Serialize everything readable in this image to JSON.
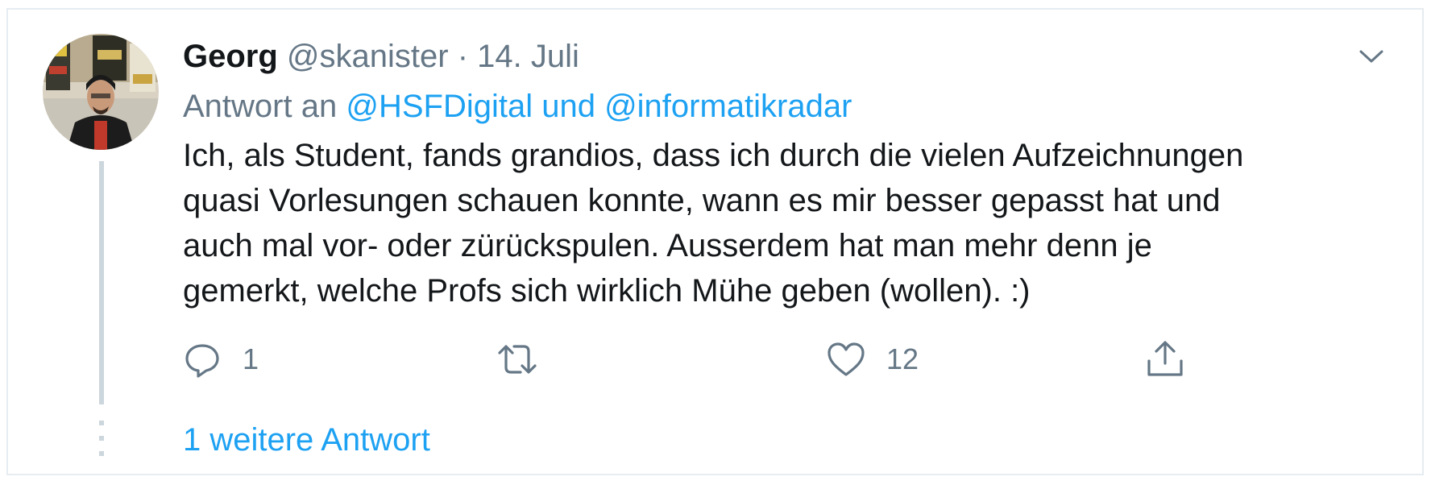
{
  "tweet": {
    "author_name": "Georg",
    "handle": "@skanister",
    "separator": "·",
    "date": "14. Juli",
    "reply_prefix": "Antwort an",
    "reply_mentions": "@HSFDigital und @informatikradar",
    "text_lines": [
      "Ich, als Student, fands grandios, dass ich durch die vielen Aufzeichnungen",
      "quasi Vorlesungen schauen konnte, wann es mir besser gepasst hat und",
      "auch mal vor- oder zürückspulen. Ausserdem hat man mehr denn je",
      "gemerkt, welche Profs sich wirklich Mühe geben (wollen). :)"
    ],
    "actions": {
      "reply": {
        "icon": "reply-icon",
        "count": "1"
      },
      "retweet": {
        "icon": "retweet-icon",
        "count": ""
      },
      "like": {
        "icon": "heart-icon",
        "count": "12"
      },
      "share": {
        "icon": "share-icon"
      }
    },
    "more_replies_label": "1 weitere Antwort"
  },
  "colors": {
    "accent": "#1da1f2",
    "secondary_text": "#657786",
    "primary_text": "#14171a",
    "thread_line": "#ccd6dd",
    "border": "#e6ecf0"
  },
  "icons": {
    "avatar": "user-avatar-photo",
    "caret": "chevron-down-icon"
  }
}
